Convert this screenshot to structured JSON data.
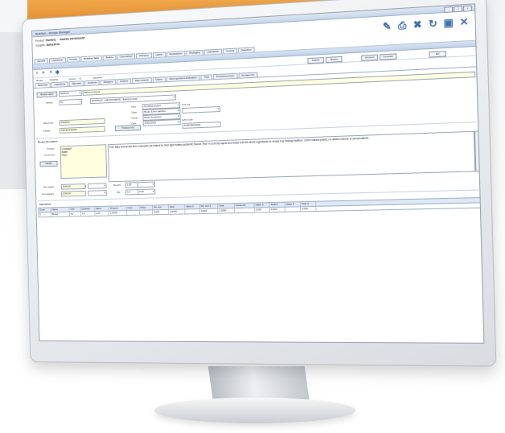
{
  "window": {
    "title": "Nutrition - Recipe Manager",
    "buttons": [
      "_",
      "□",
      "×"
    ]
  },
  "header": {
    "row1_label": "Product:",
    "row1_code": "PA00001",
    "row1_name": "BAKED CROISSANT",
    "row2_label": "Supplier:",
    "row2_value": "BAKERY01"
  },
  "toolbar_icons": [
    "pencil-icon",
    "printer-icon",
    "delete-icon",
    "refresh-icon",
    "save-icon",
    "close-icon"
  ],
  "tabs_top": [
    "General",
    "Ingredients",
    "Product",
    "Nutrition facts",
    "Recipe",
    "Composition",
    "Allergens",
    "Labels",
    "Declarations",
    "Packaging",
    "Calculation",
    "Costing",
    "Suppliers"
  ],
  "tools": {
    "search": "Search",
    "history": "History",
    "versions": "Versions",
    "compare": "Compare",
    "lang": "EN"
  },
  "info": {
    "recipe_label": "Recipe",
    "recipe_value": "PA00001",
    "version_label": "Version",
    "version_value": "01",
    "status": "Approved"
  },
  "tabs_second": [
    "Overview",
    "Ingredients",
    "Materials",
    "Nutrients",
    "Allergens",
    "Analysis",
    "Raw material",
    "Claims",
    "Raw ingredient declaration",
    "Yield",
    "Processing steps",
    "Storage info"
  ],
  "form": {
    "name_label": "Recipe name",
    "name_code": "PA00001",
    "name_value": "Baked croissant",
    "version_label": "Version",
    "version_value": "01",
    "version_desc": "PASTRIES - VIENNOISERIE / Baked product",
    "type_label": "Type",
    "type_value": "Finished product",
    "type_extra": "Unit: kg",
    "sub1_label": "Class",
    "sub1_value": "Bread & fine pastries",
    "sub2_label": "Group",
    "sub2_value": "Bread & pastries",
    "date_label": "Date",
    "date_value": "01/01/2016",
    "ref_label": "Reference",
    "ref_value": "PA00001",
    "family_label": "Family",
    "family_value": "VIENNOISERIE",
    "ean_label": "EAN code",
    "ean_value": "3000000000001",
    "product_button": "Product info",
    "section_title": "Recipe description",
    "field_label": "Product",
    "field_values": [
      "Croissant",
      "Butter",
      "Flour"
    ],
    "comments_label": "Comments",
    "button_label": "Modify",
    "description": "Puff, flaky and tender fine croissants are baked for their light buttery authentic flavour. Rich in crunchy layers and made with the finest ingredients to reveal true baking tradition. 100% natural pastry, no added colours or preservatives.",
    "weight_label": "Net weight",
    "weight_value": "1000,00",
    "weight_unit": "g",
    "net_label": "Net quantity",
    "net_value": "1000,00",
    "density_label": "Density",
    "density_value": "1,00",
    "qty_label": "Qty",
    "qty_value": "1,0",
    "loss_label": "Loss",
    "loss_value": "0,00"
  },
  "grid": {
    "title": "Ingredients",
    "headers": [
      "Code",
      "Name",
      "Unit",
      "Quantity",
      "Value",
      "Amount",
      "Cost",
      "Price",
      "Per unit",
      "Rate",
      "Value 2",
      "Per unit 2",
      "Total",
      "Customer",
      "Value 3",
      "Total 2",
      "Value 4",
      "Total 3"
    ],
    "rows": [
      [
        "0",
        "Bread",
        "kg",
        "1.0",
        "1,00",
        "1,0000",
        "",
        "",
        "0,000",
        "1,0000",
        "",
        "0,000",
        "1,0000",
        "",
        "0,000",
        "0,000",
        "",
        "0,000"
      ]
    ]
  }
}
